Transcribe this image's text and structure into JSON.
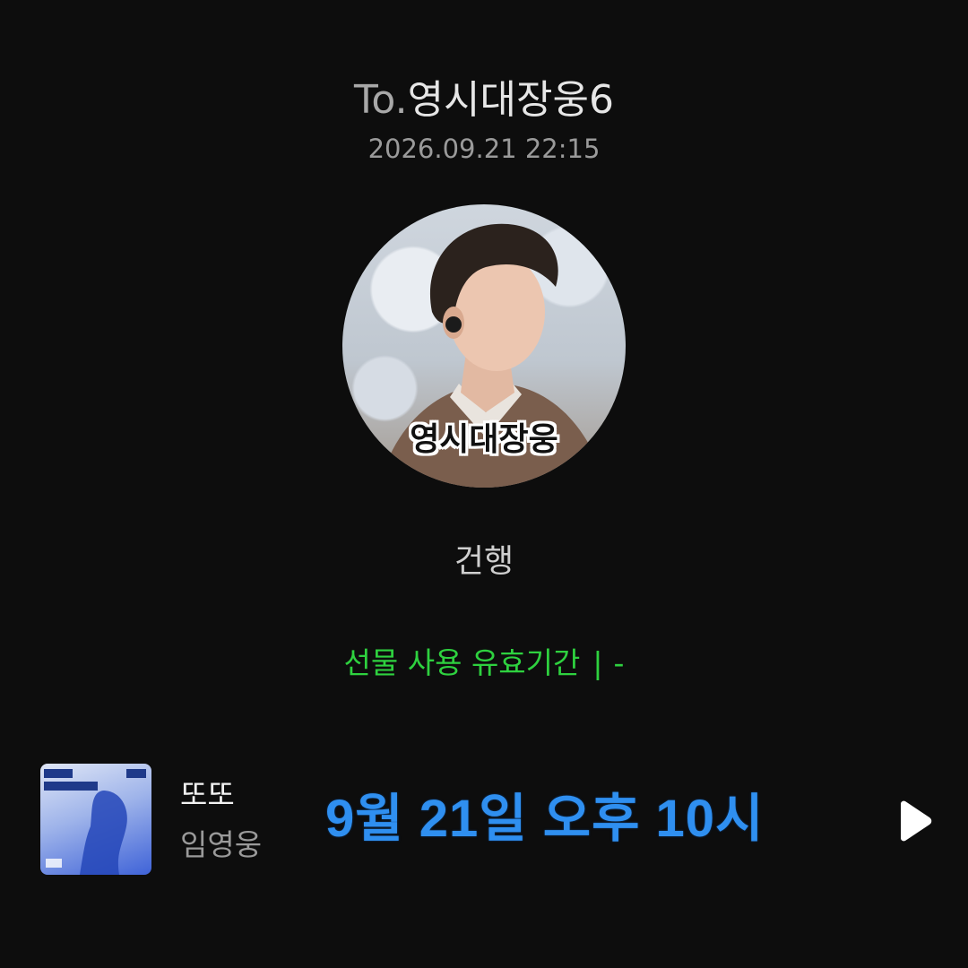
{
  "header": {
    "to_prefix": "To.",
    "recipient_name": "영시대장웅6",
    "timestamp": "2026.09.21 22:15"
  },
  "avatar": {
    "caption": "영시대장웅"
  },
  "message": {
    "text": "건행"
  },
  "validity": {
    "label": "선물 사용 유효기간",
    "separator": "|",
    "value": "-"
  },
  "music": {
    "song_title": "또또",
    "artist": "임영웅",
    "overlay_text": "9월 21일 오후 10시",
    "album_icon": "album-cover-image",
    "play_icon": "play-icon"
  },
  "colors": {
    "background": "#0d0d0d",
    "validity_green": "#2ed13f",
    "overlay_blue": "#2f8ff0"
  }
}
